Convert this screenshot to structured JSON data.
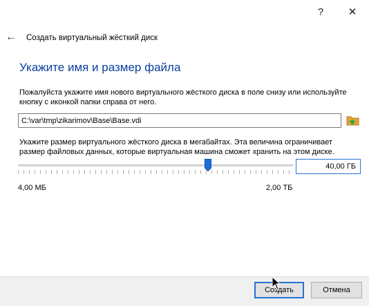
{
  "window": {
    "help_glyph": "?",
    "close_glyph": "✕"
  },
  "header": {
    "back_glyph": "←",
    "title": "Создать виртуальный жёсткий диск"
  },
  "page": {
    "heading": "Укажите имя и размер файла",
    "file_description": "Пожалуйста укажите имя нового виртуального жёсткого диска в поле снизу или используйте кнопку с иконкой папки справа от него.",
    "file_path": "C:\\var\\tmp\\zikarimov\\Base\\Base.vdi",
    "size_description": "Укажите размер виртуального жёсткого диска в мегабайтах. Эта величина ограничивает размер файловых данных, которые виртуальная машина сможет хранить на этом диске.",
    "size_value": "40,00 ГБ",
    "slider": {
      "min_label": "4,00 МБ",
      "max_label": "2,00 ТБ",
      "position_fraction": 0.69
    }
  },
  "footer": {
    "create_label": "Создать",
    "cancel_label": "Отмена"
  },
  "colors": {
    "heading": "#0b3f9e",
    "accent": "#2a6fd6",
    "folder_icon": "#e8a33a",
    "folder_arrow": "#3aa63a"
  }
}
